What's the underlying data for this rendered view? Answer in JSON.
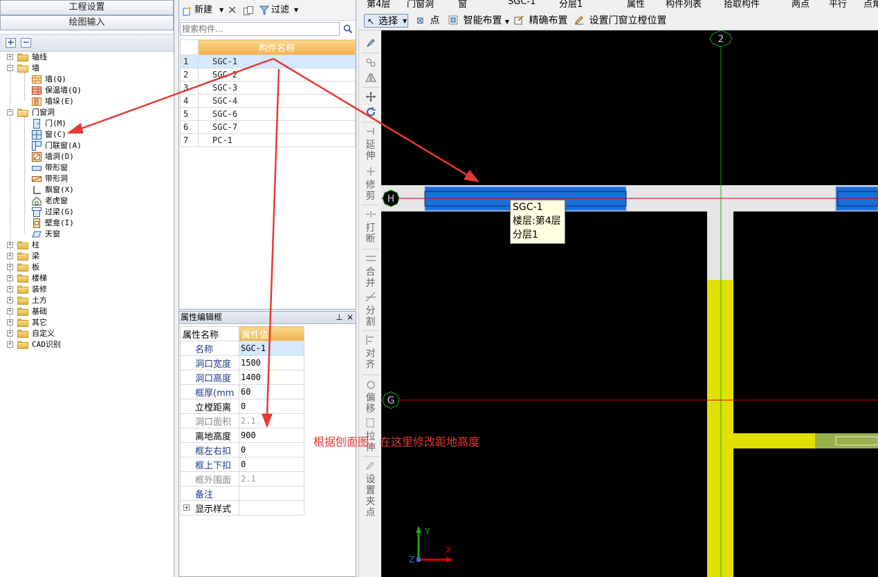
{
  "left_nav": {
    "project_settings": "工程设置",
    "drawing_input": "绘图输入",
    "toolbar": {
      "expand": "+",
      "collapse": "−"
    },
    "tree": [
      {
        "label": "轴线",
        "type": "folder",
        "state": "collapsed"
      },
      {
        "label": "墙",
        "type": "folder",
        "state": "expanded",
        "children": [
          {
            "label": "墙(Q)",
            "icon": "wall-icon"
          },
          {
            "label": "保温墙(Q)",
            "icon": "insulation-wall-icon"
          },
          {
            "label": "墙垛(E)",
            "icon": "wall-pier-icon"
          }
        ]
      },
      {
        "label": "门窗洞",
        "type": "folder",
        "state": "expanded",
        "children": [
          {
            "label": "门(M)",
            "icon": "door-icon"
          },
          {
            "label": "窗(C)",
            "icon": "window-icon"
          },
          {
            "label": "门联窗(A)",
            "icon": "door-window-icon"
          },
          {
            "label": "墙洞(D)",
            "icon": "wall-opening-icon"
          },
          {
            "label": "带形窗",
            "icon": "strip-window-icon"
          },
          {
            "label": "带形洞",
            "icon": "strip-opening-icon"
          },
          {
            "label": "飘窗(X)",
            "icon": "bay-window-icon"
          },
          {
            "label": "老虎窗",
            "icon": "dormer-window-icon"
          },
          {
            "label": "过梁(G)",
            "icon": "lintel-icon"
          },
          {
            "label": "壁龛(I)",
            "icon": "niche-icon"
          },
          {
            "label": "天窗",
            "icon": "skylight-icon"
          }
        ]
      },
      {
        "label": "柱",
        "type": "folder",
        "state": "collapsed"
      },
      {
        "label": "梁",
        "type": "folder",
        "state": "collapsed"
      },
      {
        "label": "板",
        "type": "folder",
        "state": "collapsed"
      },
      {
        "label": "楼梯",
        "type": "folder",
        "state": "collapsed"
      },
      {
        "label": "装修",
        "type": "folder",
        "state": "collapsed"
      },
      {
        "label": "土方",
        "type": "folder",
        "state": "collapsed"
      },
      {
        "label": "基础",
        "type": "folder",
        "state": "collapsed"
      },
      {
        "label": "其它",
        "type": "folder",
        "state": "collapsed"
      },
      {
        "label": "自定义",
        "type": "folder",
        "state": "collapsed"
      },
      {
        "label": "CAD识别",
        "type": "folder",
        "state": "collapsed"
      }
    ]
  },
  "component_list": {
    "toolbar": {
      "new": "新建",
      "filter": "过滤"
    },
    "search_placeholder": "搜索构件...",
    "header": "构件名称",
    "rows": [
      {
        "index": "1",
        "name": "SGC-1",
        "selected": true
      },
      {
        "index": "2",
        "name": "SGC-2"
      },
      {
        "index": "3",
        "name": "SGC-3"
      },
      {
        "index": "4",
        "name": "SGC-4"
      },
      {
        "index": "5",
        "name": "SGC-6"
      },
      {
        "index": "6",
        "name": "SGC-7"
      },
      {
        "index": "7",
        "name": "PC-1"
      }
    ]
  },
  "property_panel": {
    "title": "属性编辑框",
    "pin": "⊥",
    "close": "×",
    "headers": {
      "name": "属性名称",
      "value": "属性值"
    },
    "rows": [
      {
        "name": "名称",
        "value": "SGC-1",
        "color": "blue",
        "selected": true
      },
      {
        "name": "洞口宽度",
        "value": "1500",
        "color": "blue"
      },
      {
        "name": "洞口高度",
        "value": "1400",
        "color": "blue"
      },
      {
        "name": "框厚(mm",
        "value": "60",
        "color": "blue"
      },
      {
        "name": "立樘距离",
        "value": "0",
        "color": "black"
      },
      {
        "name": "洞口面积",
        "value": "2.1",
        "color": "gray"
      },
      {
        "name": "离地高度",
        "value": "900",
        "color": "black"
      },
      {
        "name": "框左右扣",
        "value": "0",
        "color": "blue"
      },
      {
        "name": "框上下扣",
        "value": "0",
        "color": "blue"
      },
      {
        "name": "框外围面",
        "value": "2.1",
        "color": "gray"
      },
      {
        "name": "备注",
        "value": "",
        "color": "blue"
      },
      {
        "name": "显示样式",
        "value": "",
        "color": "black",
        "expandable": true
      }
    ]
  },
  "top_toolbar_partial": [
    "第4层",
    "门窗洞",
    "窗",
    "SGC-1",
    "分层1",
    "属性",
    "构件列表",
    "拾取构件",
    "两点",
    "平行",
    "点角"
  ],
  "main_toolbar": {
    "select": "选择",
    "point": "点",
    "smart_layout": "智能布置",
    "precise_layout": "精确布置",
    "set_position": "设置门窗立樘位置"
  },
  "vertical_tools": [
    "延伸",
    "修剪",
    "打断",
    "合并",
    "分割",
    "对齐",
    "偏移",
    "拉伸",
    "设置夹点"
  ],
  "canvas": {
    "axis_labels": {
      "top": "2",
      "h": "H",
      "g": "G"
    },
    "tooltip": {
      "name": "SGC-1",
      "floor": "楼层:第4层",
      "layer": "分层1"
    },
    "ucs": {
      "x": "X",
      "y": "Y",
      "z": "Z"
    },
    "colors": {
      "window": "#1a6fd8",
      "wall": "#e6e6e6",
      "column": "#e2e000",
      "axis_red": "#e00000",
      "axis_green": "#1fa61f"
    }
  },
  "annotation": "根据刨面图，在这里修改距地高度",
  "colors": {
    "accent_orange": "#f0b24c",
    "selection_blue": "#d6e8fb",
    "arrow_red": "#e53935"
  }
}
